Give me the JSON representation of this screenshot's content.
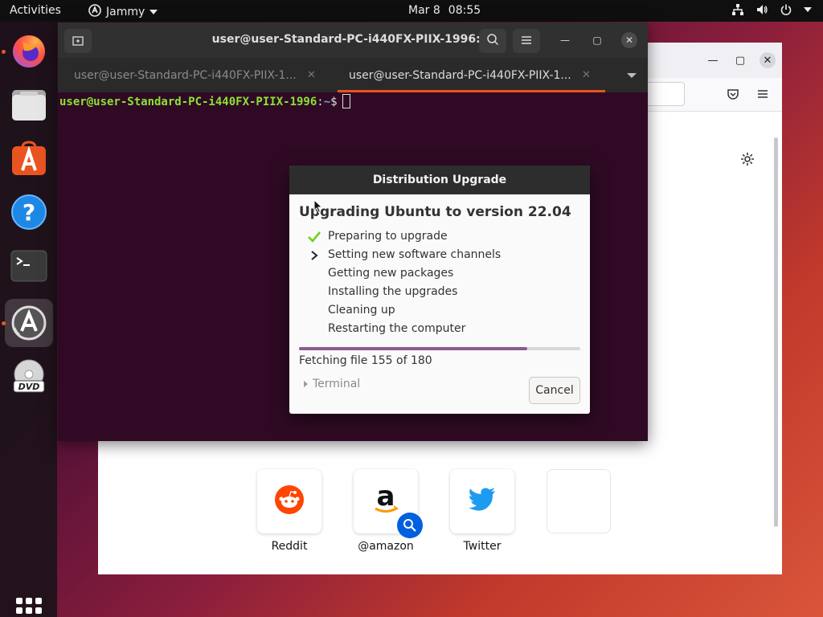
{
  "topbar": {
    "activities": "Activities",
    "app_name": "Jammy",
    "date": "Mar 8",
    "time": "08:55"
  },
  "dock": {
    "items": [
      "firefox-icon",
      "files-icon",
      "software-center-icon",
      "help-icon",
      "terminal-icon",
      "software-updater-icon",
      "dvd-icon",
      "show-applications-icon"
    ],
    "accent_color": "#e95420"
  },
  "firefox": {
    "shortcuts": [
      {
        "label": "Reddit"
      },
      {
        "label": "@amazon"
      },
      {
        "label": "Twitter"
      },
      {
        "label": ""
      }
    ]
  },
  "terminal": {
    "title": "user@user-Standard-PC-i440FX-PIIX-1996: ~",
    "tabs": [
      {
        "label": "user@user-Standard-PC-i440FX-PIIX-1...",
        "active": false
      },
      {
        "label": "user@user-Standard-PC-i440FX-PIIX-1...",
        "active": true
      }
    ],
    "prompt": {
      "user": "user@user-Standard-PC-i440FX-PIIX-1996",
      "path": "~",
      "sign": "$"
    },
    "background": "#300a24"
  },
  "dialog": {
    "title": "Distribution Upgrade",
    "heading": "Upgrading Ubuntu to version 22.04",
    "steps": [
      {
        "label": "Preparing to upgrade",
        "state": "done"
      },
      {
        "label": "Setting new software channels",
        "state": "current"
      },
      {
        "label": "Getting new packages",
        "state": "pending"
      },
      {
        "label": "Installing the upgrades",
        "state": "pending"
      },
      {
        "label": "Cleaning up",
        "state": "pending"
      },
      {
        "label": "Restarting the computer",
        "state": "pending"
      }
    ],
    "progress": 0.81,
    "status": "Fetching file 155 of 180",
    "terminal_expander": "Terminal",
    "cancel_label": "Cancel"
  }
}
